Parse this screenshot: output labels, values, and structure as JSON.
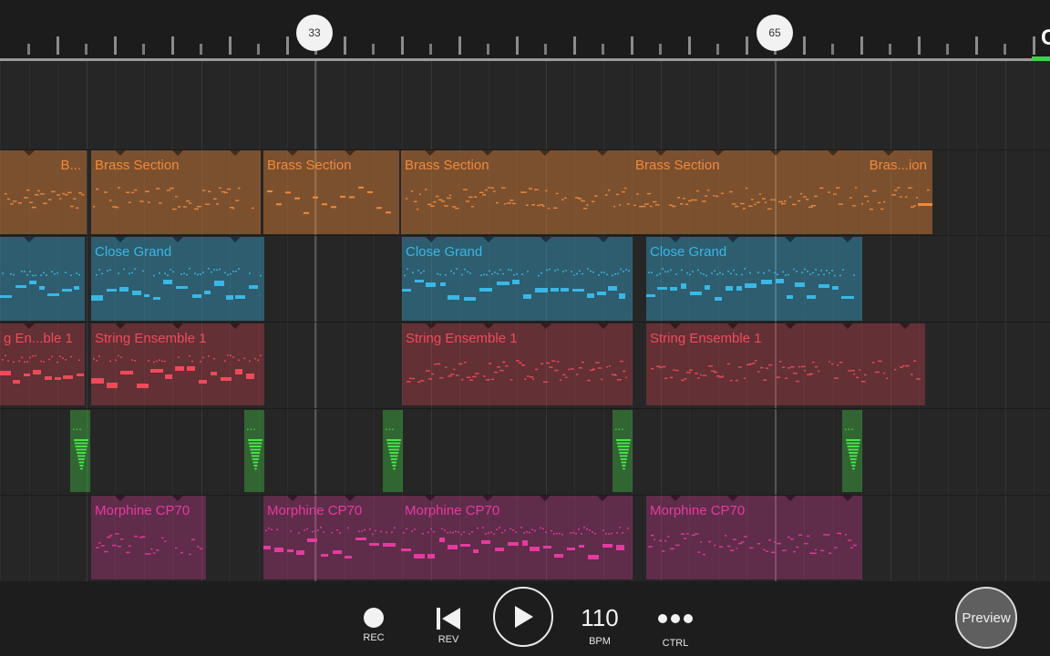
{
  "ruler": {
    "markers": [
      "33",
      "65"
    ]
  },
  "colors": {
    "brass": "#f08a3c",
    "piano": "#3ab7e6",
    "strings": "#f04a5a",
    "drums": "#49e04a",
    "organ": "#e63aa0"
  },
  "tracks": [
    {
      "id": "brass",
      "clips": [
        {
          "label": "B..."
        },
        {
          "label": "Brass Section"
        },
        {
          "label": "Brass Section"
        },
        {
          "label": "Brass Section"
        },
        {
          "label": "Brass Section"
        },
        {
          "label": "Bras...ion"
        }
      ]
    },
    {
      "id": "piano",
      "clips": [
        {
          "label": ""
        },
        {
          "label": "Close Grand"
        },
        {
          "label": "Close Grand"
        },
        {
          "label": "Close Grand"
        }
      ]
    },
    {
      "id": "strings",
      "clips": [
        {
          "label": "g En...ble 1"
        },
        {
          "label": "String Ensemble 1"
        },
        {
          "label": "String Ensemble 1"
        },
        {
          "label": "String Ensemble 1"
        }
      ]
    },
    {
      "id": "drums",
      "clips": [
        {
          "label": "..."
        },
        {
          "label": "..."
        },
        {
          "label": "..."
        },
        {
          "label": "..."
        },
        {
          "label": "..."
        }
      ]
    },
    {
      "id": "organ",
      "clips": [
        {
          "label": "Morphine CP70"
        },
        {
          "label": "Morphine CP70"
        },
        {
          "label": "Morphine CP70"
        },
        {
          "label": "Morphine CP70"
        }
      ]
    }
  ],
  "transport": {
    "rec_label": "REC",
    "rev_label": "REV",
    "tempo": "110",
    "tempo_unit": "BPM",
    "ctrl_label": "CTRL",
    "preview_label": "Preview",
    "edge_text": "C"
  }
}
